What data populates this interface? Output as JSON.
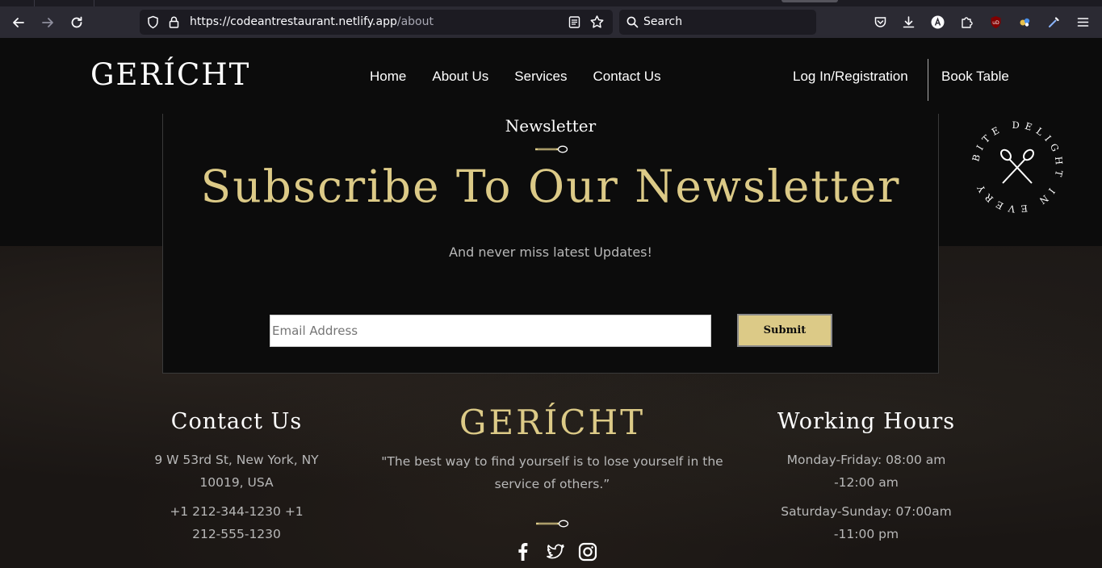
{
  "browser": {
    "url_host": "https://codeantrestaurant.netlify.app",
    "url_path": "/about",
    "search_placeholder": "Search"
  },
  "nav": {
    "logo": "GERÍCHT",
    "links": [
      "Home",
      "About Us",
      "Services",
      "Contact Us"
    ],
    "login": "Log In/Registration",
    "book_table": "Book Table"
  },
  "newsletter": {
    "subheading": "Newsletter",
    "title": "Subscribe To Our Newsletter",
    "description": "And never miss latest Updates!",
    "email_placeholder": "Email Address",
    "submit_label": "Submit"
  },
  "badge": {
    "text": "BITE DELIGHT IN EVERY"
  },
  "footer": {
    "contact": {
      "heading": "Contact Us",
      "address_line1": "9 W 53rd St, New York, NY",
      "address_line2": "10019, USA",
      "phone_line1": "+1 212-344-1230 +1",
      "phone_line2": "212-555-1230"
    },
    "brand": {
      "logo": "GERÍCHT",
      "quote_line1": "\"The best way to find yourself is to lose yourself in the",
      "quote_line2": "service of others.”"
    },
    "hours": {
      "heading": "Working Hours",
      "weekday_line1": "Monday-Friday: 08:00 am",
      "weekday_line2": "-12:00 am",
      "weekend_line1": "Saturday-Sunday: 07:00am",
      "weekend_line2": "-11:00 pm"
    }
  },
  "colors": {
    "gold": "#dcca87",
    "page_bg": "#0c0c0c",
    "chrome_bg": "#2b2a33"
  }
}
